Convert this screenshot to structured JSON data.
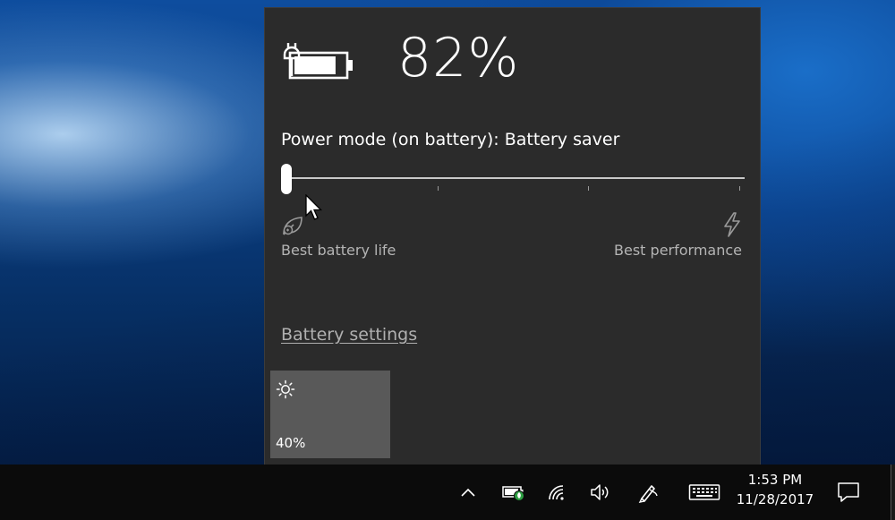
{
  "battery": {
    "percent": "82%",
    "level": 0.82
  },
  "power_mode": {
    "label": "Power mode (on battery): Battery saver",
    "position": 0,
    "positions_count": 4,
    "left_label": "Best battery life",
    "right_label": "Best performance"
  },
  "links": {
    "battery_settings": "Battery settings"
  },
  "quick_actions": {
    "brightness": "40%"
  },
  "taskbar": {
    "time": "1:53 PM",
    "date": "11/28/2017"
  },
  "icons": {
    "battery": "battery-icon",
    "leaf": "battery-saver-leaf-icon",
    "bolt": "performance-bolt-icon",
    "sun": "brightness-sun-icon",
    "chevron": "chevron-up-icon",
    "network": "wifi-icon",
    "volume": "volume-icon",
    "pen": "pen-workspace-icon",
    "keyboard": "touch-keyboard-icon",
    "notifications": "action-center-icon"
  },
  "colors": {
    "flyout_bg": "#2b2b2b",
    "tile_bg": "#595959",
    "taskbar_bg": "#0b0b0b",
    "charging_badge": "#2ea043"
  }
}
